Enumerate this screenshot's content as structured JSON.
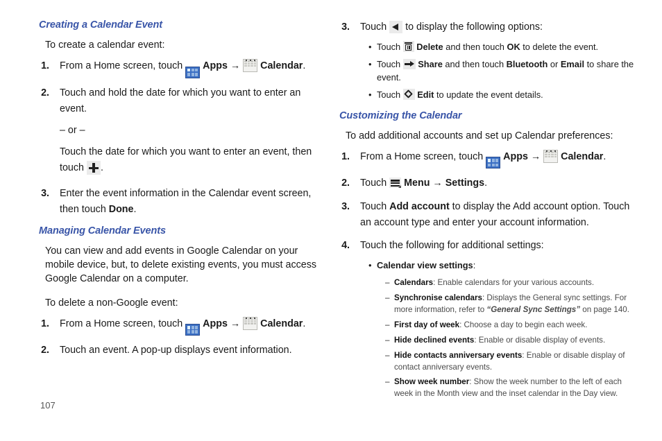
{
  "page": {
    "number": "107",
    "heading_color": "#3955a8"
  },
  "left_column": {
    "section1": {
      "heading": "Creating a Calendar Event",
      "lead": "To create a calendar event:",
      "steps": [
        {
          "num": "1.",
          "pre": "From a Home screen, touch ",
          "apps_label": "Apps",
          "arrow": "→",
          "calendar_label": "Calendar",
          "post": "."
        },
        {
          "num": "2.",
          "line1": "Touch and hold the date for which you want to enter an event.",
          "or_divider": "– or –",
          "line2_pre": "Touch the date for which you want to enter an event, then touch ",
          "line2_post": "."
        },
        {
          "num": "3.",
          "pre": "Enter the event information in the Calendar event screen, then touch ",
          "bold": "Done",
          "post": "."
        }
      ]
    },
    "section2": {
      "heading": "Managing Calendar Events",
      "paragraph": "You can view and add events in Google Calendar on your mobile device, but, to delete existing events, you must access Google Calendar on a computer.",
      "lead": "To delete a non-Google event:",
      "steps": [
        {
          "num": "1.",
          "pre": "From a Home screen, touch ",
          "apps_label": "Apps",
          "arrow": "→",
          "calendar_label": "Calendar",
          "post": "."
        },
        {
          "num": "2.",
          "text": "Touch an event. A pop-up displays event information."
        }
      ]
    }
  },
  "right_column": {
    "step3": {
      "num": "3.",
      "pre": "Touch ",
      "post": " to display the following options:",
      "bullets": [
        {
          "pre": "Touch ",
          "bold1": "Delete",
          "mid": " and then touch ",
          "bold2": "OK",
          "post": " to delete the event."
        },
        {
          "pre": "Touch ",
          "bold1": "Share",
          "mid": " and then touch ",
          "bold2": "Bluetooth",
          "mid2": " or ",
          "bold3": "Email",
          "post": " to share the event."
        },
        {
          "pre": "Touch ",
          "bold1": "Edit",
          "post": " to update the event details."
        }
      ]
    },
    "section3": {
      "heading": "Customizing the Calendar",
      "lead": "To add additional accounts and set up Calendar preferences:",
      "steps": [
        {
          "num": "1.",
          "pre": "From a Home screen, touch ",
          "apps_label": "Apps",
          "arrow": "→",
          "calendar_label": "Calendar",
          "post": "."
        },
        {
          "num": "2.",
          "pre": "Touch ",
          "menu_label": "Menu",
          "arrow": "→",
          "settings_label": "Settings",
          "post": "."
        },
        {
          "num": "3.",
          "pre": "Touch ",
          "bold": "Add account",
          "post": " to display the Add account option. Touch an account type and enter your account information."
        },
        {
          "num": "4.",
          "text": "Touch the following for additional settings:"
        }
      ],
      "bullet": {
        "bold": "Calendar view settings",
        "post": ":"
      },
      "subitems": [
        {
          "bold": "Calendars",
          "text": ": Enable calendars for your various accounts."
        },
        {
          "bold": "Synchronise calendars",
          "text": ": Displays the General sync settings. For more information, refer to ",
          "italic_quote": "“General Sync Settings”",
          "tail": " on page 140."
        },
        {
          "bold": "First day of week",
          "text": ": Choose a day to begin each week."
        },
        {
          "bold": "Hide declined events",
          "text": ": Enable or disable display of events."
        },
        {
          "bold": "Hide contacts anniversary events",
          "text": ": Enable or disable display of contact anniversary events."
        },
        {
          "bold": "Show week number",
          "text": ": Show the week number to the left of each week in the Month view and the inset calendar in the Day view."
        }
      ]
    }
  },
  "icons": {
    "apps": "apps-grid-icon",
    "calendar": "calendar-icon",
    "plus": "plus-icon",
    "back": "back-arrow-icon",
    "trash": "trash-icon",
    "share": "share-arrow-icon",
    "edit": "edit-icon",
    "menu": "hamburger-menu-icon"
  }
}
